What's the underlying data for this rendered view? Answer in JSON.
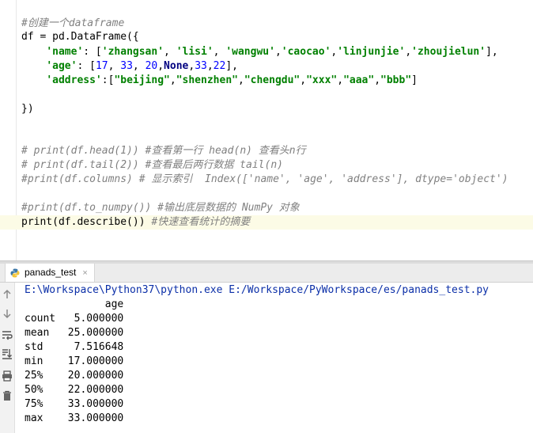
{
  "editor": {
    "lines": [
      "#创建一个dataframe",
      "df = pd.DataFrame({",
      "    'name': ['zhangsan', 'lisi', 'wangwu','caocao','linjunjie','zhoujielun'],",
      "    'age': [17, 33, 20,None,33,22],",
      "    'address':[\"beijing\",\"shenzhen\",\"chengdu\",\"xxx\",\"aaa\",\"bbb\"]",
      "",
      "})",
      "",
      "",
      "# print(df.head(1)) #查看第一行 head(n) 查看头n行",
      "# print(df.tail(2)) #查看最后两行数据 tail(n)",
      "#print(df.columns) # 显示索引  Index(['name', 'age', 'address'], dtype='object')",
      "",
      "#print(df.to_numpy()) #输出底层数据的 NumPy 对象",
      "print(df.describe()) #快速查看统计的摘要"
    ]
  },
  "run_tab": {
    "label": "panads_test",
    "close": "×"
  },
  "console": {
    "command": "E:\\Workspace\\Python37\\python.exe E:/Workspace/PyWorkspace/es/panads_test.py",
    "header": "             age",
    "rows": [
      "count   5.000000",
      "mean   25.000000",
      "std     7.516648",
      "min    17.000000",
      "25%    20.000000",
      "50%    22.000000",
      "75%    33.000000",
      "max    33.000000"
    ]
  },
  "icons": {
    "tab_icon": "python-icon",
    "tools": [
      "arrow-up-icon",
      "arrow-down-icon",
      "soft-wrap-icon",
      "scroll-to-end-icon",
      "print-icon",
      "trash-icon"
    ]
  },
  "colors": {
    "comment": "#808080",
    "string": "#008000",
    "number": "#0000ff",
    "keyword": "#000080",
    "command": "#0b2fa8",
    "current_line": "#fcfbe6"
  }
}
